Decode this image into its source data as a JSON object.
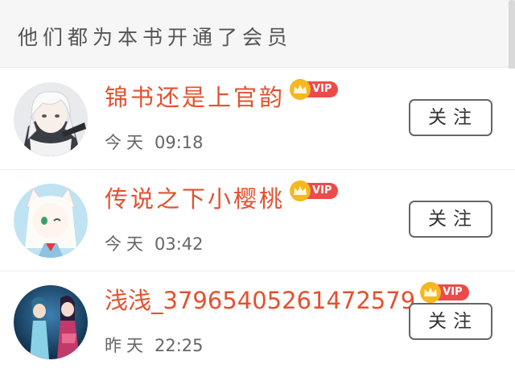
{
  "header": {
    "title": "他们都为本书开通了会员"
  },
  "vip_label": "VIP",
  "colors": {
    "name": "#e4512f",
    "vip_pill": "#ee4a4a",
    "crown": "#f5b722"
  },
  "members": [
    {
      "name": "锦书还是上官韵",
      "day": "今天",
      "time": "09:18",
      "follow_label": "关注",
      "avatar": "white-hair-character-avatar"
    },
    {
      "name": "传说之下小樱桃",
      "day": "今天",
      "time": "03:42",
      "follow_label": "关注",
      "avatar": "white-fox-girl-avatar"
    },
    {
      "name": "浅浅_37965405261472579",
      "day": "昨天",
      "time": "22:25",
      "follow_label": "关注",
      "avatar": "anime-couple-avatar"
    }
  ]
}
